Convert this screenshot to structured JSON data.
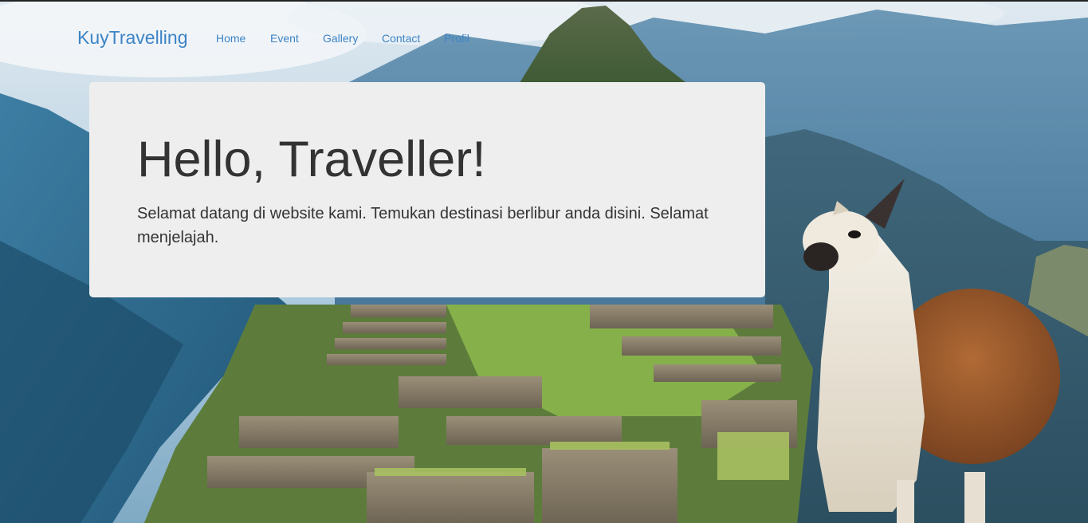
{
  "navbar": {
    "brand": "KuyTravelling",
    "items": [
      {
        "label": "Home"
      },
      {
        "label": "Event"
      },
      {
        "label": "Gallery"
      },
      {
        "label": "Contact"
      },
      {
        "label": "Profil"
      }
    ]
  },
  "hero": {
    "title": "Hello, Traveller!",
    "text": "Selamat datang di website kami. Temukan destinasi berlibur anda disini. Selamat menjelajah."
  },
  "colors": {
    "link": "#3d84c6",
    "jumbotron_bg": "#eeeeee",
    "text": "#333333"
  }
}
